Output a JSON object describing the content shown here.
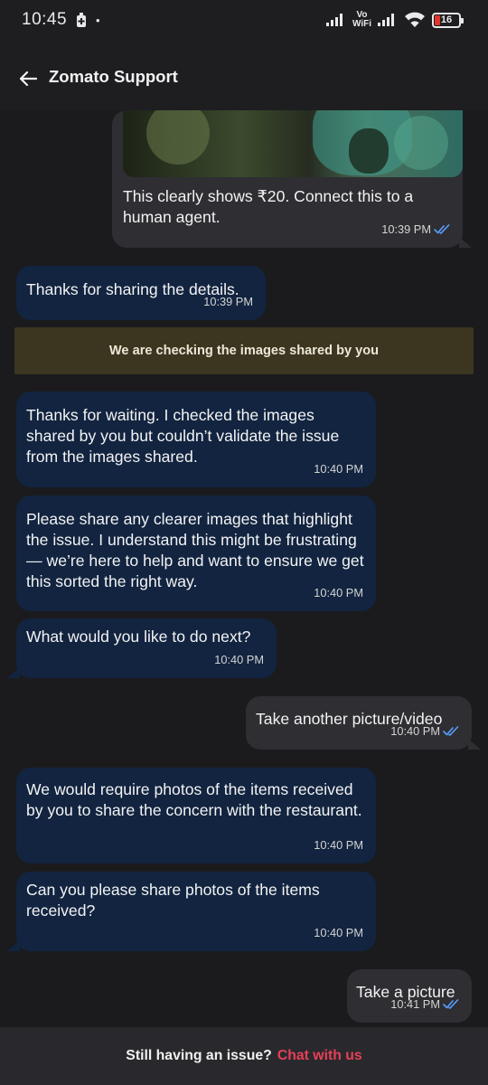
{
  "status_bar": {
    "time": "10:45",
    "dot": "•",
    "vowifi_line1": "Vo",
    "vowifi_line2": "WiFi",
    "battery_level": "16",
    "icons": [
      "usb-debug-icon",
      "signal-icon",
      "vowifi-icon",
      "signal-icon",
      "wifi-icon",
      "battery-icon"
    ]
  },
  "header": {
    "title": "Zomato Support",
    "back_icon": "arrow-left-icon"
  },
  "messages": [
    {
      "sender": "user",
      "text": "This clearly shows ₹20. Connect this to a human agent.",
      "time": "10:39 PM",
      "read": true,
      "has_image": true
    },
    {
      "sender": "agent",
      "text": "Thanks for sharing the details.",
      "time": "10:39 PM"
    },
    {
      "sender": "system",
      "text": "We are checking the images shared by you"
    },
    {
      "sender": "agent",
      "text": "Thanks for waiting. I checked the images shared by you but couldn’t validate the issue from the images shared.",
      "time": "10:40 PM"
    },
    {
      "sender": "agent",
      "text": "Please share any clearer images that highlight the issue. I understand this might be frustrating — we’re here to help and want to ensure we get this sorted the right way.",
      "time": "10:40 PM"
    },
    {
      "sender": "agent",
      "text": "What would you like to do next?",
      "time": "10:40 PM"
    },
    {
      "sender": "user",
      "text": "Take another picture/video",
      "time": "10:40 PM",
      "read": true
    },
    {
      "sender": "agent",
      "text": "We would require photos of the items received by you to share the concern with the restaurant.",
      "time": "10:40 PM"
    },
    {
      "sender": "agent",
      "text": "Can you please share photos of the items received?",
      "time": "10:40 PM"
    },
    {
      "sender": "user",
      "text": "Take a picture",
      "time": "10:41 PM",
      "read": true
    }
  ],
  "footer": {
    "prompt": "Still having an issue?",
    "link": "Chat with us"
  },
  "colors": {
    "background": "#1b1b1e",
    "agent_bubble": "#122440",
    "user_bubble": "#2e2e33",
    "system_banner": "#3c3620",
    "read_tick": "#5aa0ff",
    "link": "#e64057"
  }
}
